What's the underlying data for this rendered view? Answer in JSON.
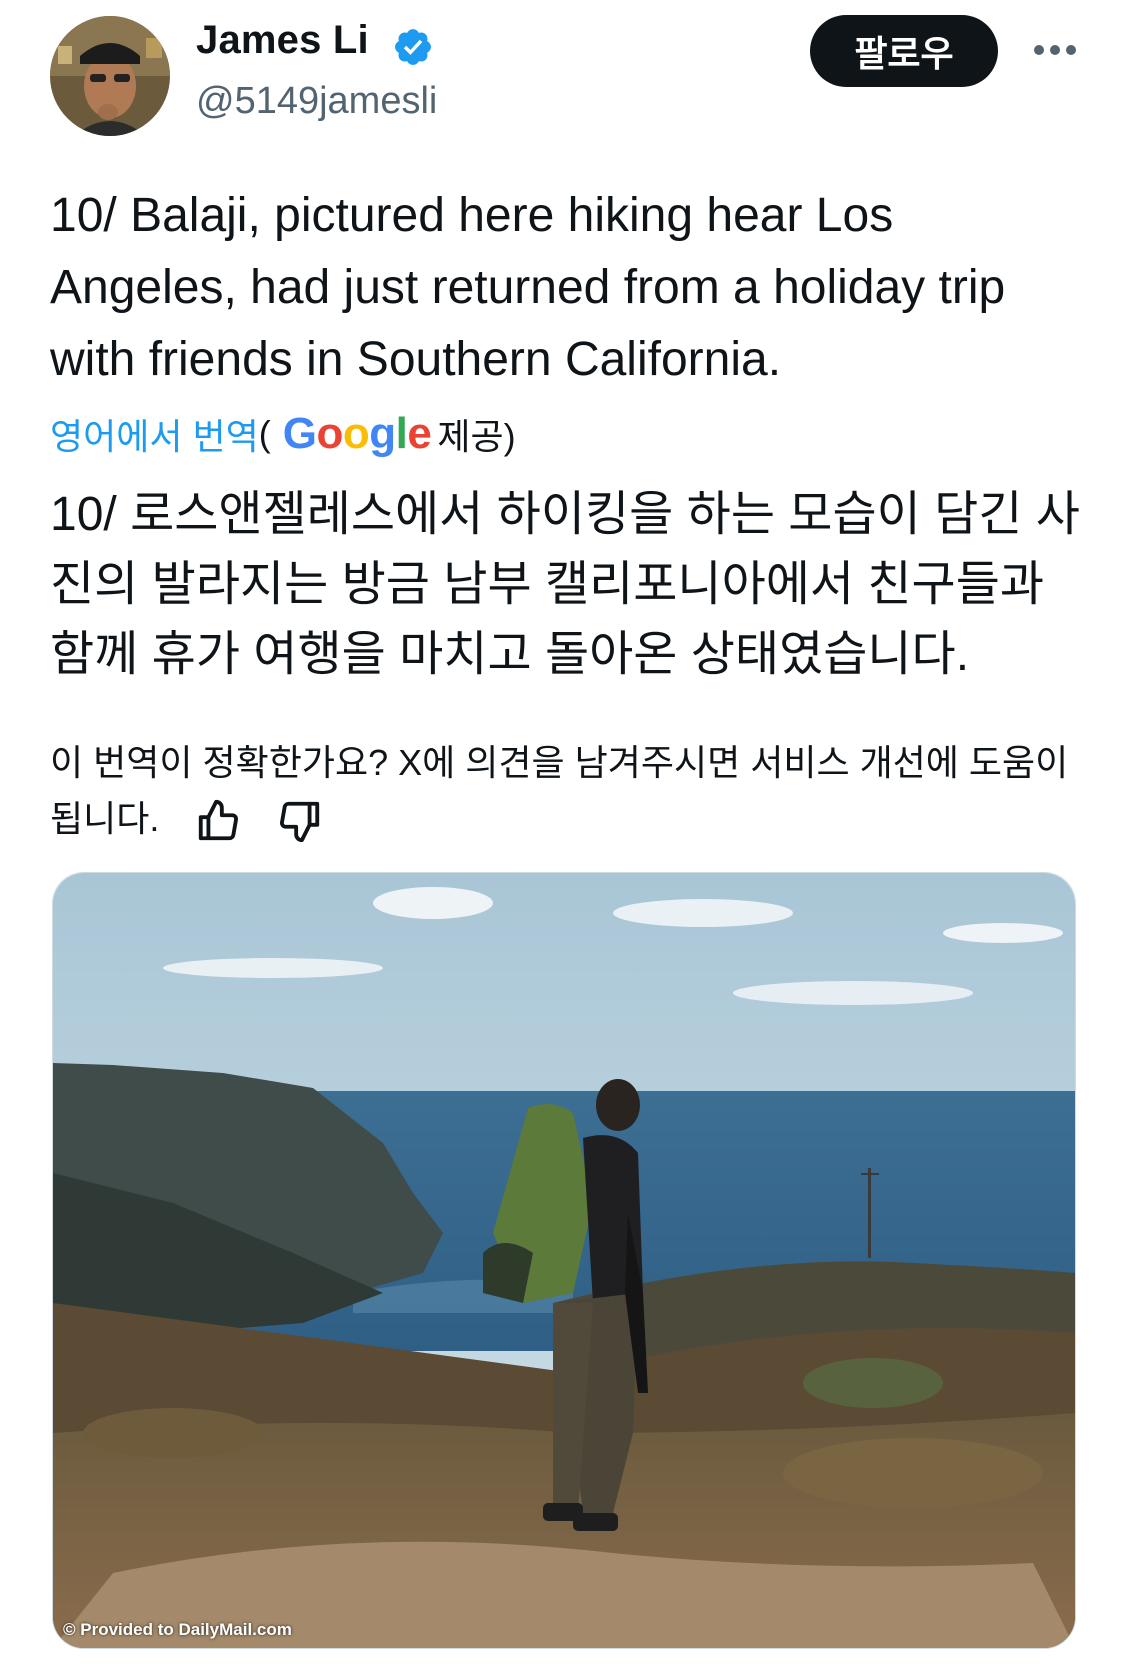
{
  "user": {
    "name": "James Li",
    "handle": "@5149jamesli",
    "avatar_icon": "avatar-photo",
    "verified_color": "#1d9bf0"
  },
  "follow_label": "팔로우",
  "more_icon": "more-horizontal-icon",
  "tweet": {
    "text": "10/ Balaji, pictured here hiking hear Los Angeles, had just returned from a holiday trip with friends in Southern California."
  },
  "translation": {
    "link": "영어에서 번역",
    "open_paren": "(",
    "provider_logo": "Google",
    "provided_suffix": "제공)",
    "text": "10/ 로스앤젤레스에서 하이킹을 하는 모습이 담긴 사진의 발라지는 방금 남부 캘리포니아에서 친구들과 함께 휴가 여행을 마치고 돌아온 상태였습니다.",
    "feedback": "이 번역이 정확한가요? X에 의견을 남겨주시면 서비스 개선에 도움이 됩니다.",
    "thumbs_up_icon": "thumbs-up-icon",
    "thumbs_down_icon": "thumbs-down-icon"
  },
  "media": {
    "watermark": "© Provided to DailyMail.com"
  },
  "colors": {
    "text": "#0f1419",
    "secondary": "#536471",
    "link": "#1d9bf0",
    "button": "#0f1419"
  }
}
